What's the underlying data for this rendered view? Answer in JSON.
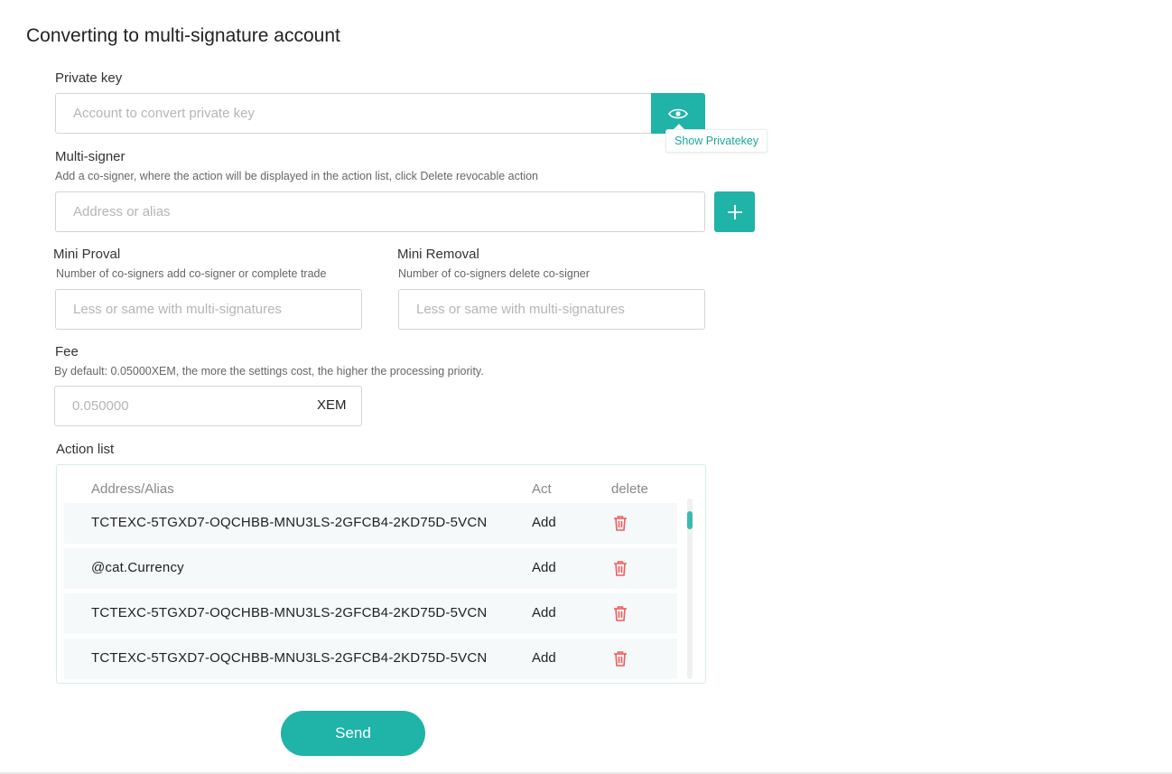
{
  "page": {
    "title": "Converting to multi-signature account"
  },
  "private_key": {
    "label": "Private key",
    "placeholder": "Account to convert private key",
    "show_button_icon": "eye-icon",
    "tooltip": "Show Privatekey"
  },
  "multi_signer": {
    "label": "Multi-signer",
    "hint": "Add a co-signer, where the action will be displayed in the action list, click Delete revocable action",
    "placeholder": "Address or alias",
    "add_button_icon": "plus-icon"
  },
  "mini_approval": {
    "label": "Mini Proval",
    "hint": "Number of co-signers add co-signer or complete trade",
    "placeholder": "Less or same with multi-signatures"
  },
  "mini_removal": {
    "label": "Mini Removal",
    "hint": "Number of co-signers delete co-signer",
    "placeholder": "Less or same with multi-signatures"
  },
  "fee": {
    "label": "Fee",
    "hint": "By default: 0.05000XEM, the more the settings cost, the higher the processing priority.",
    "placeholder": "0.050000",
    "unit": "XEM"
  },
  "action_list": {
    "label": "Action list",
    "columns": {
      "address": "Address/Alias",
      "act": "Act",
      "delete": "delete"
    },
    "rows": [
      {
        "address": "TCTEXC-5TGXD7-OQCHBB-MNU3LS-2GFCB4-2KD75D-5VCN",
        "act": "Add",
        "delete_icon": "trash-icon"
      },
      {
        "address": "@cat.Currency",
        "act": "Add",
        "delete_icon": "trash-icon"
      },
      {
        "address": "TCTEXC-5TGXD7-OQCHBB-MNU3LS-2GFCB4-2KD75D-5VCN",
        "act": "Add",
        "delete_icon": "trash-icon"
      },
      {
        "address": "TCTEXC-5TGXD7-OQCHBB-MNU3LS-2GFCB4-2KD75D-5VCN",
        "act": "Add",
        "delete_icon": "trash-icon"
      }
    ]
  },
  "send_button": {
    "label": "Send"
  },
  "colors": {
    "accent": "#20b3a8",
    "danger": "#f15b5b"
  }
}
